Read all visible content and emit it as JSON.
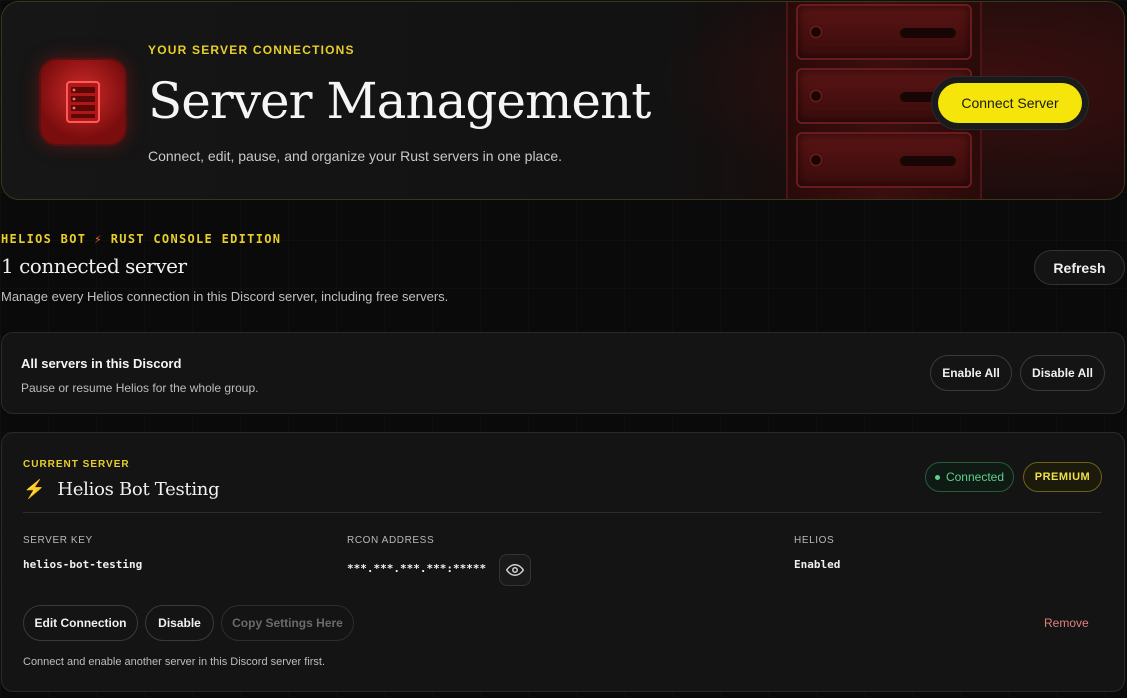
{
  "hero": {
    "eyebrow": "YOUR SERVER CONNECTIONS",
    "title": "Server Management",
    "subtitle": "Connect, edit, pause, and organize your Rust servers in one place.",
    "connect_button": "Connect Server",
    "icon": "server-rack-icon"
  },
  "brand": {
    "name": "HELIOS BOT",
    "separator_icon": "bolt-icon",
    "edition": "RUST CONSOLE EDITION"
  },
  "summary": {
    "count_title": "1 connected server",
    "description": "Manage every Helios connection in this Discord server, including free servers.",
    "refresh_button": "Refresh"
  },
  "group": {
    "title": "All servers in this Discord",
    "subtitle": "Pause or resume Helios for the whole group.",
    "enable_all": "Enable All",
    "disable_all": "Disable All"
  },
  "current_server": {
    "label": "CURRENT SERVER",
    "name": "Helios Bot Testing",
    "status": "Connected",
    "tier": "PREMIUM",
    "fields": {
      "server_key_label": "SERVER KEY",
      "server_key": "helios-bot-testing",
      "rcon_label": "RCON ADDRESS",
      "rcon": "***.***.***.***:*****",
      "helios_label": "HELIOS",
      "helios": "Enabled"
    },
    "actions": {
      "edit": "Edit Connection",
      "disable": "Disable",
      "copy": "Copy Settings Here",
      "remove": "Remove"
    },
    "footnote": "Connect and enable another server in this Discord server first."
  },
  "colors": {
    "accent_yellow": "#f5e50a",
    "eyebrow_yellow": "#e8cf2a",
    "connected_green": "#5fcf8a",
    "remove_red": "#e27f7f",
    "bolt_orange": "#f06a3a"
  }
}
